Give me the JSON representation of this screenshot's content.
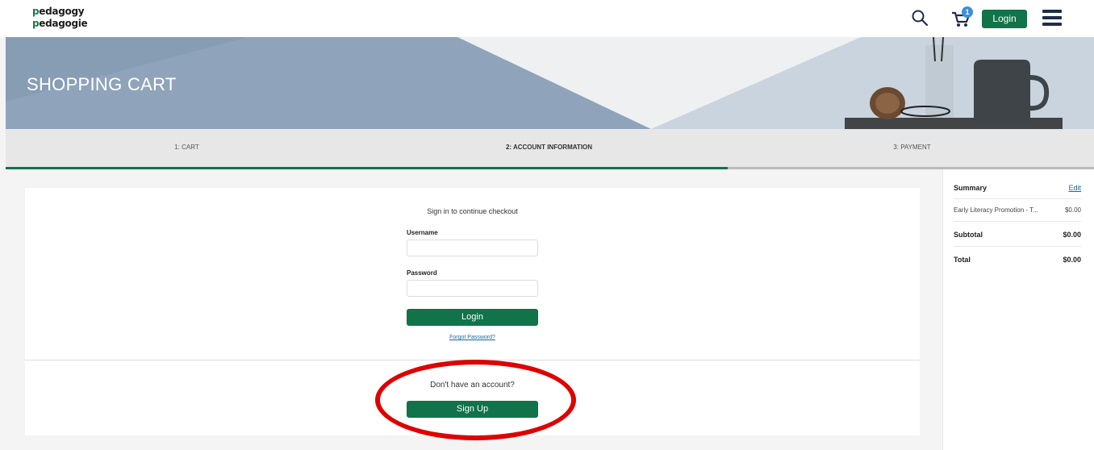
{
  "header": {
    "logo_line1_mark": "p",
    "logo_line1_rest": "edagogy",
    "logo_line2_mark": "p",
    "logo_line2_rest": "edagogie",
    "cart_count": "1",
    "login_label": "Login",
    "icons": [
      "search-icon",
      "cart-icon",
      "menu-icon"
    ]
  },
  "banner": {
    "title": "SHOPPING CART"
  },
  "steps": [
    {
      "label": "1: CART",
      "active": false
    },
    {
      "label": "2: ACCOUNT INFORMATION",
      "active": true
    },
    {
      "label": "3: PAYMENT",
      "active": false
    }
  ],
  "signin": {
    "title": "Sign in to continue checkout",
    "username_label": "Username",
    "username_value": "",
    "password_label": "Password",
    "password_value": "",
    "login_button": "Login",
    "forgot_link": "Forgot Password?",
    "no_account_text": "Don't have an account?",
    "signup_button": "Sign Up"
  },
  "summary": {
    "title": "Summary",
    "edit_label": "Edit",
    "items": [
      {
        "name": "Early Literacy Promotion - T...",
        "price": "$0.00"
      }
    ],
    "subtotal_label": "Subtotal",
    "subtotal_value": "$0.00",
    "total_label": "Total",
    "total_value": "$0.00"
  },
  "colors": {
    "accent_green": "#11734a",
    "annotation_red": "#e00000",
    "link_blue": "#1a6b9a",
    "badge_blue": "#3b8fd9"
  }
}
